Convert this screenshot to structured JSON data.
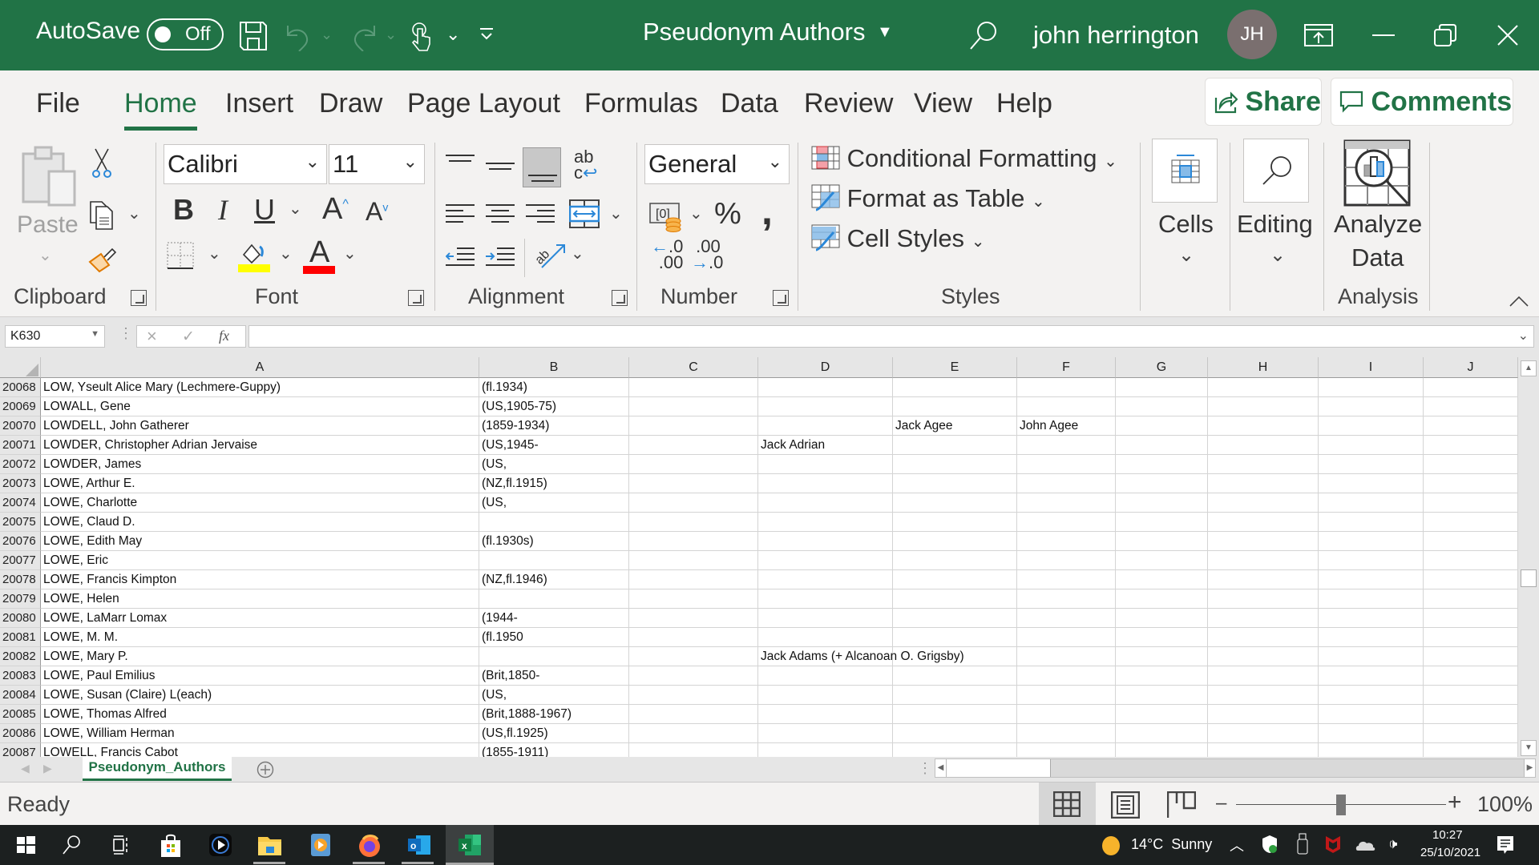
{
  "titlebar": {
    "autosave_label": "AutoSave",
    "autosave_state": "Off",
    "document_title": "Pseudonym Authors",
    "user_name": "john herrington",
    "user_initials": "JH",
    "accent_color": "#217346"
  },
  "tabs": {
    "items": [
      "File",
      "Home",
      "Insert",
      "Draw",
      "Page Layout",
      "Formulas",
      "Data",
      "Review",
      "View",
      "Help"
    ],
    "active": "Home",
    "share_label": "Share",
    "comments_label": "Comments"
  },
  "ribbon": {
    "clipboard": {
      "paste_label": "Paste",
      "group_label": "Clipboard"
    },
    "font": {
      "font_name": "Calibri",
      "font_size": "11",
      "group_label": "Font",
      "highlight_color": "#ffff00",
      "font_color": "#ff0000"
    },
    "alignment": {
      "group_label": "Alignment"
    },
    "number": {
      "format": "General",
      "group_label": "Number",
      "percent": "%",
      "comma": ",",
      "inc_decimal": "←.0 .00",
      "dec_decimal": ".00 →.0"
    },
    "styles": {
      "conditional_formatting": "Conditional Formatting",
      "format_as_table": "Format as Table",
      "cell_styles": "Cell Styles",
      "group_label": "Styles"
    },
    "cells": {
      "label": "Cells"
    },
    "editing": {
      "label": "Editing"
    },
    "analysis": {
      "analyze_line1": "Analyze",
      "analyze_line2": "Data",
      "group_label": "Analysis"
    }
  },
  "formula_bar": {
    "name_box": "K630",
    "fx": "fx",
    "formula": ""
  },
  "sheet": {
    "columns": [
      "A",
      "B",
      "C",
      "D",
      "E",
      "F",
      "G",
      "H",
      "I",
      "J"
    ],
    "rows": [
      {
        "num": "20068",
        "A": "LOW, Yseult Alice Mary (Lechmere-Guppy)",
        "B": "(fl.1934)",
        "D": "",
        "E": "",
        "F": ""
      },
      {
        "num": "20069",
        "A": "LOWALL, Gene",
        "B": "(US,1905-75)",
        "D": "",
        "E": "",
        "F": ""
      },
      {
        "num": "20070",
        "A": "LOWDELL, John Gatherer",
        "B": "(1859-1934)",
        "D": "",
        "E": "Jack Agee",
        "F": "John Agee"
      },
      {
        "num": "20071",
        "A": "LOWDER, Christopher Adrian Jervaise",
        "B": "(US,1945-",
        "D": "Jack Adrian",
        "E": "",
        "F": ""
      },
      {
        "num": "20072",
        "A": "LOWDER, James",
        "B": "(US,",
        "D": "",
        "E": "",
        "F": ""
      },
      {
        "num": "20073",
        "A": "LOWE, Arthur E.",
        "B": "(NZ,fl.1915)",
        "D": "",
        "E": "",
        "F": ""
      },
      {
        "num": "20074",
        "A": "LOWE, Charlotte",
        "B": "(US,",
        "D": "",
        "E": "",
        "F": ""
      },
      {
        "num": "20075",
        "A": "LOWE, Claud D.",
        "B": "",
        "D": "",
        "E": "",
        "F": ""
      },
      {
        "num": "20076",
        "A": "LOWE, Edith May",
        "B": "(fl.1930s)",
        "D": "",
        "E": "",
        "F": ""
      },
      {
        "num": "20077",
        "A": "LOWE, Eric",
        "B": "",
        "D": "",
        "E": "",
        "F": ""
      },
      {
        "num": "20078",
        "A": "LOWE, Francis Kimpton",
        "B": "(NZ,fl.1946)",
        "D": "",
        "E": "",
        "F": ""
      },
      {
        "num": "20079",
        "A": "LOWE, Helen",
        "B": "",
        "D": "",
        "E": "",
        "F": ""
      },
      {
        "num": "20080",
        "A": "LOWE, LaMarr Lomax",
        "B": "(1944-",
        "D": "",
        "E": "",
        "F": ""
      },
      {
        "num": "20081",
        "A": "LOWE, M. M.",
        "B": "(fl.1950",
        "D": "",
        "E": "",
        "F": ""
      },
      {
        "num": "20082",
        "A": "LOWE, Mary P.",
        "B": "",
        "D": "Jack Adams (+ Alcanoan O. Grigsby)",
        "E": "",
        "F": ""
      },
      {
        "num": "20083",
        "A": "LOWE, Paul Emilius",
        "B": "(Brit,1850-",
        "D": "",
        "E": "",
        "F": ""
      },
      {
        "num": "20084",
        "A": "LOWE, Susan (Claire) L(each)",
        "B": "(US,",
        "D": "",
        "E": "",
        "F": ""
      },
      {
        "num": "20085",
        "A": "LOWE, Thomas Alfred",
        "B": "(Brit,1888-1967)",
        "D": "",
        "E": "",
        "F": ""
      },
      {
        "num": "20086",
        "A": "LOWE, William Herman",
        "B": "(US,fl.1925)",
        "D": "",
        "E": "",
        "F": ""
      },
      {
        "num": "20087",
        "A": "LOWELL, Francis Cabot",
        "B": "(1855-1911)",
        "D": "",
        "E": "",
        "F": ""
      }
    ],
    "sheet_tab": "Pseudonym_Authors"
  },
  "status": {
    "ready": "Ready",
    "zoom_percent": "100%",
    "zoom_level": 1.0
  },
  "taskbar": {
    "weather": "14°C  Sunny",
    "time": "10:27",
    "date": "25/10/2021",
    "apps": [
      "start",
      "search",
      "task-view",
      "microsoft-store",
      "media-player",
      "file-explorer",
      "groove-music",
      "firefox",
      "outlook",
      "excel"
    ]
  }
}
